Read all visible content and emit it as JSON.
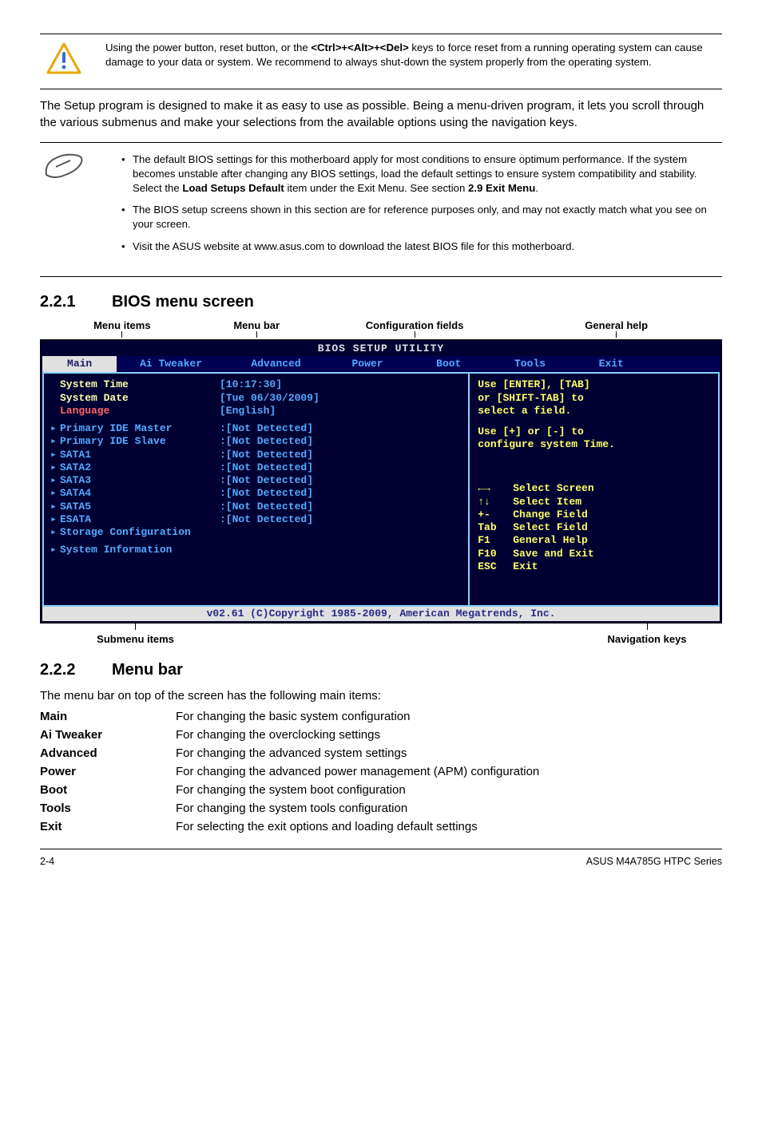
{
  "warn_text": "Using the power button, reset button, or the <Ctrl>+<Alt>+<Del> keys to force reset from a running operating system can cause damage to your data or system. We recommend to always shut-down the system properly from the operating system.",
  "intro_text": "The Setup program is designed to make it as easy to use as possible. Being a menu-driven program, it lets you scroll through the various submenus and make your selections from the available options using the navigation keys.",
  "notes": {
    "n1a": "The default BIOS settings for this motherboard apply for most conditions to ensure optimum performance. If the system becomes unstable after changing any BIOS settings, load the default settings to ensure system compatibility and stability. Select the ",
    "n1b": "Load Setups Default",
    "n1c": " item under the Exit Menu. See section ",
    "n1d": "2.9 Exit Menu",
    "n1e": ".",
    "n2": "The BIOS setup screens shown in this section are for reference purposes only, and may not exactly match what you see on your screen.",
    "n3": "Visit the ASUS website at www.asus.com to download the latest BIOS file for this motherboard."
  },
  "sec1_num": "2.2.1",
  "sec1_title": "BIOS menu screen",
  "top_labels": {
    "menu_items": "Menu items",
    "menu_bar": "Menu bar",
    "config_fields": "Configuration fields",
    "general_help": "General help"
  },
  "bios": {
    "title": "BIOS SETUP UTILITY",
    "tabs": {
      "main": "Main",
      "ai": "Ai Tweaker",
      "adv": "Advanced",
      "power": "Power",
      "boot": "Boot",
      "tools": "Tools",
      "exit": "Exit"
    },
    "left": {
      "sys_time_l": "System Time",
      "sys_time_v": "[10:17:30]",
      "sys_date_l": "System Date",
      "sys_date_v": "[Tue 06/30/2009]",
      "lang_l": "Language",
      "lang_v": "[English]",
      "pim": "Primary IDE Master",
      "pis": "Primary IDE Slave",
      "s1": "SATA1",
      "s2": "SATA2",
      "s3": "SATA3",
      "s4": "SATA4",
      "s5": "SATA5",
      "es": "ESATA",
      "nd": ":[Not Detected]",
      "storage": "Storage Configuration",
      "sysinfo": "System Information"
    },
    "right": {
      "h1": "Use [ENTER], [TAB]",
      "h2": "or [SHIFT-TAB] to",
      "h3": "select a field.",
      "h4": "Use [+] or [-] to",
      "h5": "configure system Time.",
      "nav_arrows": "←→",
      "nav_arrows_t": "Select Screen",
      "nav_ud": "↑↓",
      "nav_ud_t": "Select Item",
      "nav_pm": "+-",
      "nav_pm_t": "Change Field",
      "nav_tab": "Tab",
      "nav_tab_t": "Select Field",
      "nav_f1": "F1",
      "nav_f1_t": "General Help",
      "nav_f10": "F10",
      "nav_f10_t": "Save and Exit",
      "nav_esc": "ESC",
      "nav_esc_t": "Exit"
    },
    "footer": "v02.61 (C)Copyright 1985-2009, American Megatrends, Inc."
  },
  "under_labels": {
    "submenu": "Submenu items",
    "navkeys": "Navigation keys"
  },
  "sec2_num": "2.2.2",
  "sec2_title": "Menu bar",
  "sec2_intro": "The menu bar on top of the screen has the following main items:",
  "menu_def": {
    "main_k": "Main",
    "main_v": "For changing the basic system configuration",
    "ai_k": "Ai Tweaker",
    "ai_v": "For changing the overclocking settings",
    "adv_k": "Advanced",
    "adv_v": "For changing the advanced system settings",
    "pow_k": "Power",
    "pow_v": "For changing the advanced power management (APM) configuration",
    "boot_k": "Boot",
    "boot_v": "For changing the system boot configuration",
    "tools_k": "Tools",
    "tools_v": "For changing the system tools configuration",
    "exit_k": "Exit",
    "exit_v": "For selecting the exit options and loading default settings"
  },
  "footer_left": "2-4",
  "footer_right": "ASUS M4A785G HTPC Series"
}
